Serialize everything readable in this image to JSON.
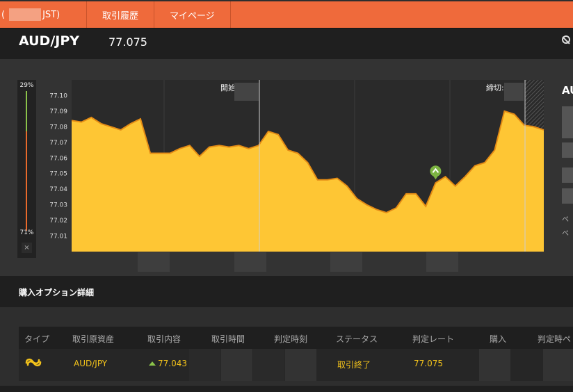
{
  "nav": {
    "tab1_left": "(",
    "tab1_right": "JST)",
    "tab2": "取引履歴",
    "tab3": "マイページ"
  },
  "header": {
    "pair": "AUD/JPY",
    "rate": "77.075"
  },
  "gauge": {
    "top_pct": "29%",
    "bottom_pct": "71%",
    "close": "×"
  },
  "chart_data": {
    "type": "area",
    "y_ticks": [
      "77.10",
      "77.09",
      "77.08",
      "77.07",
      "77.06",
      "77.05",
      "77.04",
      "77.03",
      "77.02",
      "77.01"
    ],
    "ylim": [
      77.0,
      77.11
    ],
    "annotations": {
      "start_label": "開始",
      "close_label": "締切"
    },
    "marker": {
      "at_index": 37,
      "value": 77.048
    },
    "x": [
      0,
      1,
      2,
      3,
      4,
      5,
      6,
      7,
      8,
      9,
      10,
      11,
      12,
      13,
      14,
      15,
      16,
      17,
      18,
      19,
      20,
      21,
      22,
      23,
      24,
      25,
      26,
      27,
      28,
      29,
      30,
      31,
      32,
      33,
      34,
      35,
      36,
      37,
      38,
      39,
      40,
      41,
      42,
      43,
      44,
      45,
      46,
      47,
      48
    ],
    "values": [
      77.084,
      77.083,
      77.086,
      77.082,
      77.08,
      77.078,
      77.082,
      77.085,
      77.063,
      77.063,
      77.063,
      77.066,
      77.068,
      77.061,
      77.067,
      77.068,
      77.067,
      77.068,
      77.066,
      77.068,
      77.077,
      77.075,
      77.065,
      77.063,
      77.057,
      77.046,
      77.046,
      77.047,
      77.042,
      77.034,
      77.03,
      77.027,
      77.025,
      77.028,
      77.037,
      77.037,
      77.029,
      77.044,
      77.048,
      77.042,
      77.048,
      77.055,
      77.057,
      77.065,
      77.09,
      77.088,
      77.081,
      77.08,
      77.078
    ],
    "fill_color": "#fec634",
    "line_color": "#e48b14"
  },
  "side": {
    "label": "AU",
    "note1": "ペ",
    "note2": "ペ"
  },
  "section": {
    "title": "購入オプション詳細"
  },
  "table": {
    "headers": [
      "タイプ",
      "取引原資産",
      "取引内容",
      "取引時間",
      "判定時刻",
      "ステータス",
      "判定レート",
      "購入",
      "判定時ペ"
    ],
    "row": {
      "asset": "AUD/JPY",
      "content": "77.043",
      "status": "取引終了",
      "judge_rate": "77.075"
    }
  }
}
